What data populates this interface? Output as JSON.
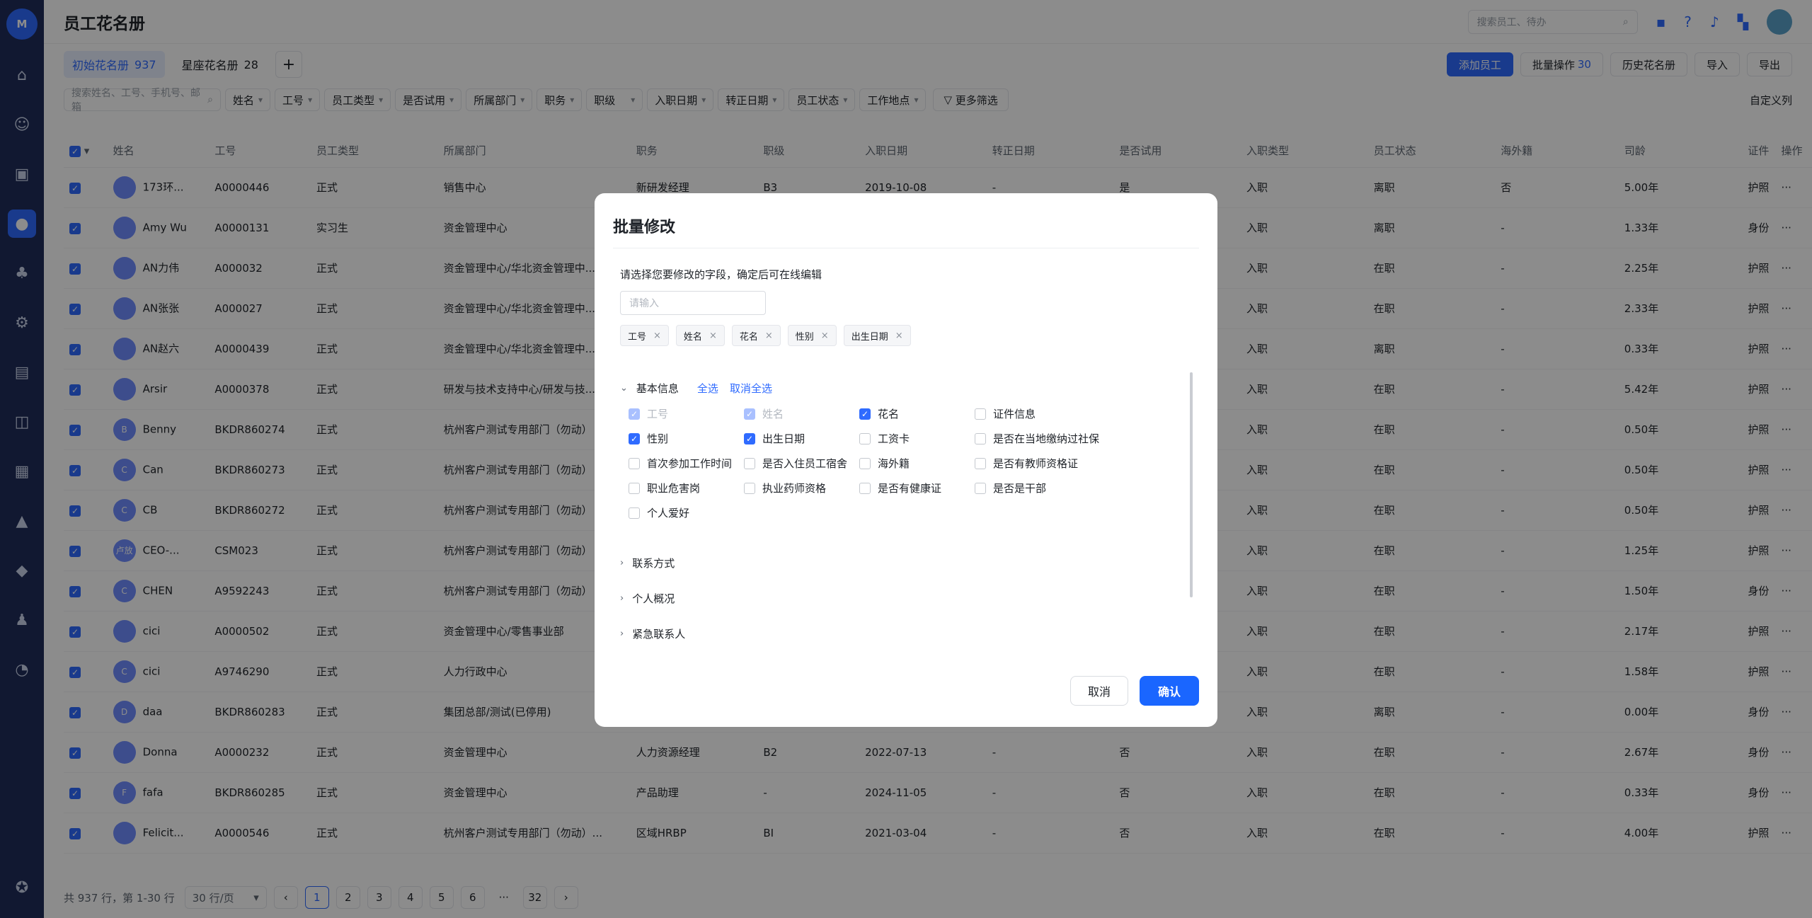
{
  "app": {
    "title": "员工花名册",
    "search_placeholder": "搜索员工、待办"
  },
  "tabs": [
    {
      "label": "初始花名册",
      "count": "937"
    },
    {
      "label": "星座花名册",
      "count": "28"
    }
  ],
  "toolbar": {
    "add": "添加员工",
    "batch": "批量操作",
    "batch_count": "30",
    "history": "历史花名册",
    "import": "导入",
    "export": "导出"
  },
  "filters": {
    "search_placeholder": "搜索姓名、工号、手机号、邮箱",
    "items": [
      "姓名",
      "工号",
      "员工类型",
      "是否试用",
      "所属部门",
      "职务",
      "职级",
      "入职日期",
      "转正日期",
      "员工状态",
      "工作地点"
    ],
    "more": "更多筛选",
    "custom_columns": "自定义列"
  },
  "table": {
    "headers": [
      "姓名",
      "工号",
      "员工类型",
      "所属部门",
      "职务",
      "职级",
      "入职日期",
      "转正日期",
      "是否试用",
      "入职类型",
      "员工状态",
      "海外籍",
      "司龄",
      "证件",
      "操作"
    ],
    "rows": [
      [
        "173环...",
        "A0000446",
        "正式",
        "销售中心",
        "新研发经理",
        "B3",
        "2019-10-08",
        "-",
        "是",
        "入职",
        "离职",
        "否",
        "5.00年",
        "护照"
      ],
      [
        "Amy Wu",
        "A0000131",
        "实习生",
        "资金管理中心",
        "",
        "",
        "",
        "",
        "",
        "入职",
        "离职",
        "-",
        "1.33年",
        "身份"
      ],
      [
        "AN力伟",
        "A000032",
        "正式",
        "资金管理中心/华北资金管理中...",
        "",
        "",
        "",
        "",
        "",
        "入职",
        "在职",
        "-",
        "2.25年",
        "护照"
      ],
      [
        "AN张张",
        "A000027",
        "正式",
        "资金管理中心/华北资金管理中...",
        "",
        "",
        "",
        "",
        "",
        "入职",
        "在职",
        "-",
        "2.33年",
        "护照"
      ],
      [
        "AN赵六",
        "A0000439",
        "正式",
        "资金管理中心/华北资金管理中...",
        "",
        "",
        "",
        "",
        "",
        "入职",
        "离职",
        "-",
        "0.33年",
        "护照"
      ],
      [
        "Arsir",
        "A0000378",
        "正式",
        "研发与技术支持中心/研发与技...",
        "",
        "",
        "",
        "",
        "",
        "入职",
        "在职",
        "-",
        "5.42年",
        "护照"
      ],
      [
        "Benny",
        "BKDR860274",
        "正式",
        "杭州客户测试专用部门（勿动）",
        "",
        "",
        "",
        "",
        "",
        "入职",
        "在职",
        "-",
        "0.50年",
        "护照"
      ],
      [
        "Can",
        "BKDR860273",
        "正式",
        "杭州客户测试专用部门（勿动）",
        "",
        "",
        "",
        "",
        "",
        "入职",
        "在职",
        "-",
        "0.50年",
        "护照"
      ],
      [
        "CB",
        "BKDR860272",
        "正式",
        "杭州客户测试专用部门（勿动）",
        "",
        "",
        "",
        "",
        "",
        "入职",
        "在职",
        "-",
        "0.50年",
        "护照"
      ],
      [
        "CEO-...",
        "CSM023",
        "正式",
        "杭州客户测试专用部门（勿动）",
        "",
        "",
        "",
        "",
        "",
        "入职",
        "在职",
        "-",
        "1.25年",
        "护照"
      ],
      [
        "CHEN",
        "A9592243",
        "正式",
        "杭州客户测试专用部门（勿动）",
        "",
        "",
        "",
        "",
        "",
        "入职",
        "在职",
        "-",
        "1.50年",
        "身份"
      ],
      [
        "cici",
        "A0000502",
        "正式",
        "资金管理中心/零售事业部",
        "",
        "",
        "",
        "",
        "",
        "入职",
        "在职",
        "-",
        "2.17年",
        "护照"
      ],
      [
        "cici",
        "A9746290",
        "正式",
        "人力行政中心",
        "",
        "",
        "",
        "",
        "",
        "入职",
        "在职",
        "-",
        "1.58年",
        "护照"
      ],
      [
        "daa",
        "BKDR860283",
        "正式",
        "集团总部/测试(已停用)",
        "",
        "",
        "",
        "",
        "",
        "入职",
        "离职",
        "-",
        "0.00年",
        "身份"
      ],
      [
        "Donna",
        "A0000232",
        "正式",
        "资金管理中心",
        "人力资源经理",
        "B2",
        "2022-07-13",
        "-",
        "否",
        "入职",
        "在职",
        "-",
        "2.67年",
        "身份"
      ],
      [
        "fafa",
        "BKDR860285",
        "正式",
        "资金管理中心",
        "产品助理",
        "-",
        "2024-11-05",
        "-",
        "否",
        "入职",
        "在职",
        "-",
        "0.33年",
        "身份"
      ],
      [
        "Felicit...",
        "A0000546",
        "正式",
        "杭州客户测试专用部门（勿动）...",
        "区域HRBP",
        "BI",
        "2021-03-04",
        "-",
        "否",
        "入职",
        "在职",
        "-",
        "4.00年",
        "护照"
      ]
    ],
    "avatar_letters": [
      "",
      "",
      "",
      "",
      "",
      "",
      "B",
      "C",
      "C",
      "卢放",
      "C",
      "",
      "C",
      "D",
      "",
      "F",
      ""
    ]
  },
  "pager": {
    "summary": "共 937 行，第 1-30 行",
    "page_size": "30 行/页",
    "pages": [
      "1",
      "2",
      "3",
      "4",
      "5",
      "6",
      "···",
      "32"
    ]
  },
  "modal": {
    "title": "批量修改",
    "desc": "请选择您要修改的字段，确定后可在线编辑",
    "input_placeholder": "请输入",
    "chips": [
      "工号",
      "姓名",
      "花名",
      "性别",
      "出生日期"
    ],
    "group_title": "基本信息",
    "select_all": "全选",
    "deselect_all": "取消全选",
    "fields": [
      {
        "label": "工号",
        "state": "disabled"
      },
      {
        "label": "姓名",
        "state": "disabled"
      },
      {
        "label": "花名",
        "state": "checked"
      },
      {
        "label": "证件信息",
        "state": "unchecked"
      },
      {
        "label": "性别",
        "state": "checked"
      },
      {
        "label": "出生日期",
        "state": "checked"
      },
      {
        "label": "工资卡",
        "state": "unchecked"
      },
      {
        "label": "是否在当地缴纳过社保",
        "state": "unchecked"
      },
      {
        "label": "首次参加工作时间",
        "state": "unchecked"
      },
      {
        "label": "是否入住员工宿舍",
        "state": "unchecked"
      },
      {
        "label": "海外籍",
        "state": "unchecked"
      },
      {
        "label": "是否有教师资格证",
        "state": "unchecked"
      },
      {
        "label": "职业危害岗",
        "state": "unchecked"
      },
      {
        "label": "执业药师资格",
        "state": "unchecked"
      },
      {
        "label": "是否有健康证",
        "state": "unchecked"
      },
      {
        "label": "是否是干部",
        "state": "unchecked"
      },
      {
        "label": "个人爱好",
        "state": "unchecked"
      }
    ],
    "sections": [
      "联系方式",
      "个人概况",
      "紧急联系人"
    ],
    "cancel": "取消",
    "confirm": "确认"
  }
}
